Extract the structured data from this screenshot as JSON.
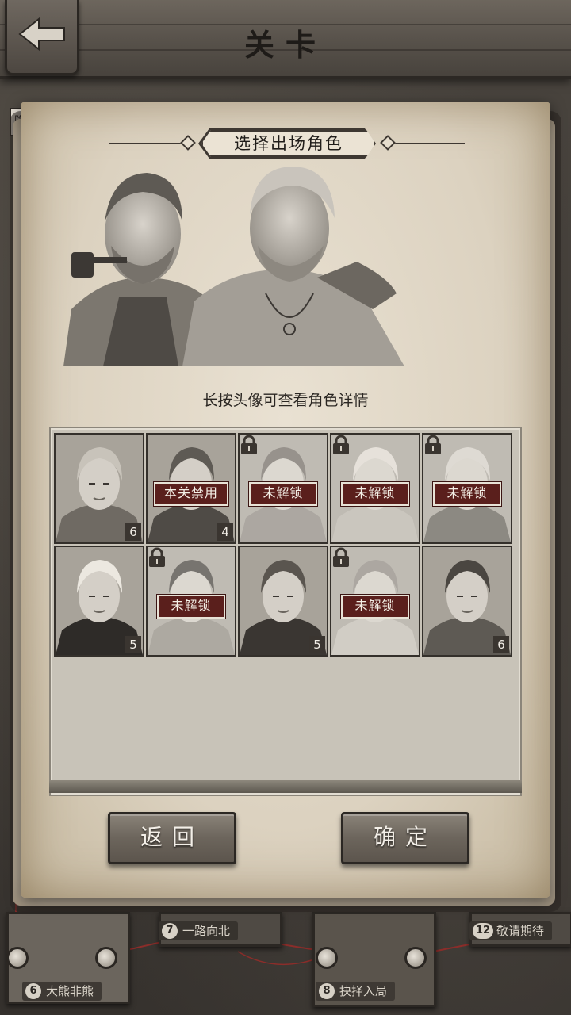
{
  "header": {
    "title": "关卡",
    "back_icon": "back-arrow-icon"
  },
  "side_tag": "隐",
  "dialog": {
    "title": "选择出场角色",
    "hint": "长按头像可查看角色详情",
    "buttons": {
      "back": "返回",
      "confirm": "确定"
    }
  },
  "characters": [
    {
      "level": "6",
      "tag": "",
      "locked": false
    },
    {
      "level": "4",
      "tag": "本关禁用",
      "locked": false
    },
    {
      "level": "",
      "tag": "未解锁",
      "locked": true
    },
    {
      "level": "",
      "tag": "未解锁",
      "locked": true
    },
    {
      "level": "",
      "tag": "未解锁",
      "locked": true
    },
    {
      "level": "5",
      "tag": "",
      "locked": false
    },
    {
      "level": "",
      "tag": "未解锁",
      "locked": true
    },
    {
      "level": "5",
      "tag": "",
      "locked": false
    },
    {
      "level": "",
      "tag": "未解锁",
      "locked": true
    },
    {
      "level": "6",
      "tag": "",
      "locked": false
    }
  ],
  "map_levels": [
    {
      "num": "6",
      "name": "大熊非熊"
    },
    {
      "num": "7",
      "name": "一路向北"
    },
    {
      "num": "8",
      "name": "抉择入局"
    },
    {
      "num": "12",
      "name": "敬请期待"
    }
  ],
  "colors": {
    "tag_bg": "#5a1f1c",
    "parchment": "#e2d9c8",
    "button": "#6c655c"
  }
}
